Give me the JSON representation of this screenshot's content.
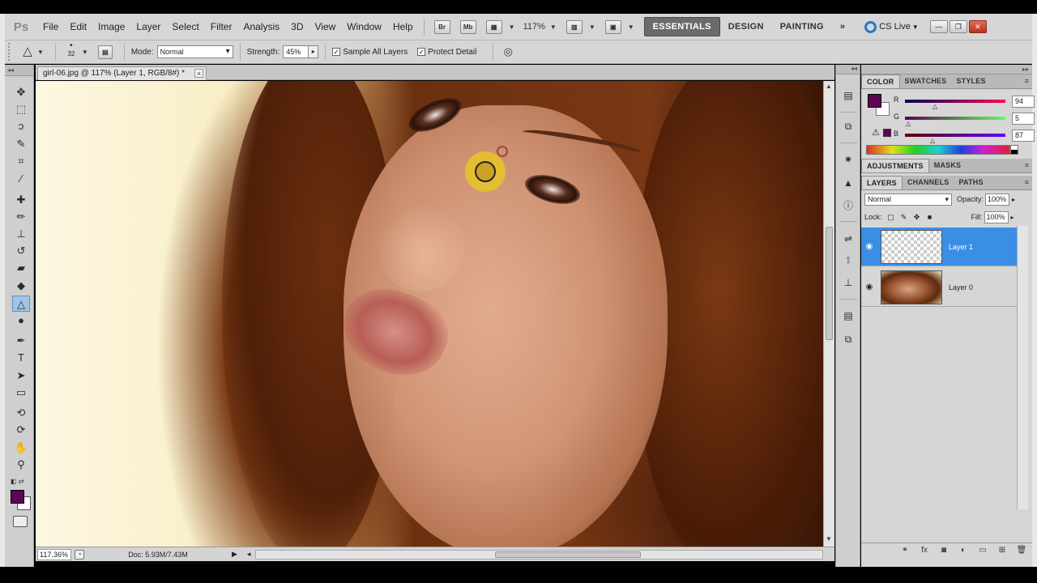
{
  "menubar": {
    "logo": "Ps",
    "items": [
      "File",
      "Edit",
      "Image",
      "Layer",
      "Select",
      "Filter",
      "Analysis",
      "3D",
      "View",
      "Window",
      "Help"
    ],
    "bridge_btn": "Br",
    "minibridge_btn": "Mb",
    "zoom": "117%",
    "workspaces": [
      "ESSENTIALS",
      "DESIGN",
      "PAINTING"
    ],
    "more": "»",
    "cslive": "CS Live"
  },
  "options": {
    "brush_size": "32",
    "mode_label": "Mode:",
    "mode_value": "Normal",
    "strength_label": "Strength:",
    "strength_value": "45%",
    "sample_all_layers": "Sample All Layers",
    "protect_detail": "Protect Detail"
  },
  "document": {
    "tab_title": "girl-06.jpg @ 117% (Layer 1, RGB/8#) *",
    "close": "×"
  },
  "status": {
    "zoom": "117.36%",
    "doc_info": "Doc: 5.93M/7.43M"
  },
  "color_panel": {
    "tabs": [
      "COLOR",
      "SWATCHES",
      "STYLES"
    ],
    "r_label": "R",
    "r_value": "94",
    "g_label": "G",
    "g_value": "5",
    "b_label": "B",
    "b_value": "87",
    "foreground": "#5e0557",
    "background": "#ffffff"
  },
  "adjustments_panel": {
    "tabs": [
      "ADJUSTMENTS",
      "MASKS"
    ]
  },
  "layers_panel": {
    "tabs": [
      "LAYERS",
      "CHANNELS",
      "PATHS"
    ],
    "blend_mode": "Normal",
    "opacity_label": "Opacity:",
    "opacity_value": "100%",
    "lock_label": "Lock:",
    "fill_label": "Fill:",
    "fill_value": "100%",
    "layers": [
      {
        "name": "Layer 1",
        "selected": true
      },
      {
        "name": "Layer 0",
        "selected": false
      }
    ]
  },
  "colors": {
    "selection_blue": "#3a8ee6",
    "ui_gray": "#d6d6d6",
    "foreground_swatch": "#5e0557"
  }
}
